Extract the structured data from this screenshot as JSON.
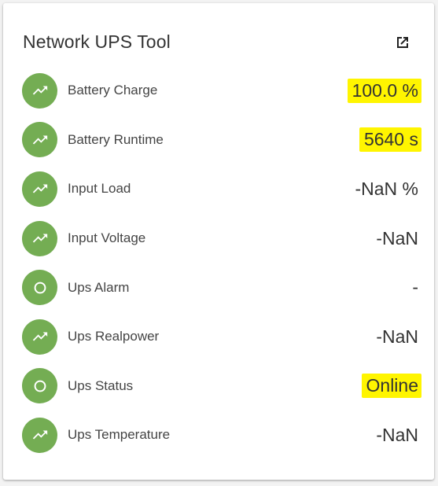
{
  "card": {
    "title": "Network UPS Tool",
    "external_link_icon": "open-in-new-icon"
  },
  "colors": {
    "badge": "#74ad53",
    "highlight": "#fff500"
  },
  "sensors": [
    {
      "label": "Battery Charge",
      "value": "100.0 %",
      "icon": "trending-up-icon",
      "highlighted": true
    },
    {
      "label": "Battery Runtime",
      "value": "5640 s",
      "icon": "trending-up-icon",
      "highlighted": true
    },
    {
      "label": "Input Load",
      "value": "-NaN %",
      "icon": "trending-up-icon",
      "highlighted": false
    },
    {
      "label": "Input Voltage",
      "value": "-NaN",
      "icon": "trending-up-icon",
      "highlighted": false
    },
    {
      "label": "Ups Alarm",
      "value": "-",
      "icon": "circle-outline-icon",
      "highlighted": false
    },
    {
      "label": "Ups Realpower",
      "value": "-NaN",
      "icon": "trending-up-icon",
      "highlighted": false
    },
    {
      "label": "Ups Status",
      "value": "Online",
      "icon": "circle-outline-icon",
      "highlighted": true
    },
    {
      "label": "Ups Temperature",
      "value": "-NaN",
      "icon": "trending-up-icon",
      "highlighted": false
    }
  ]
}
